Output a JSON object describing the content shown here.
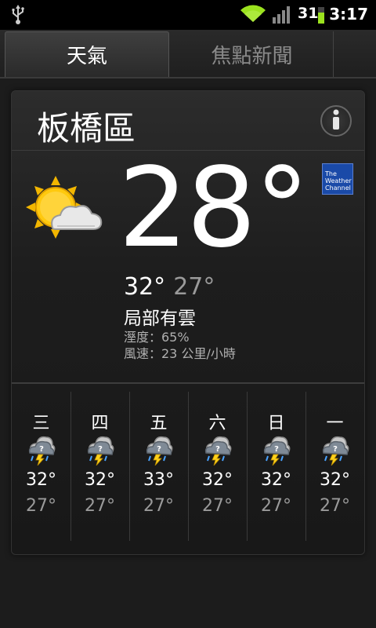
{
  "status_bar": {
    "battery": "31",
    "time": "3:17",
    "accent": "#9be21e"
  },
  "tabs": [
    {
      "label": "天氣",
      "active": true
    },
    {
      "label": "焦點新聞",
      "active": false
    }
  ],
  "current": {
    "city": "板橋區",
    "temperature": "28°",
    "high": "32°",
    "low": "27°",
    "condition": "局部有雲",
    "humidity": "溼度：65%",
    "wind": "風速：23 公里/小時",
    "provider_logo_text": "The Weather Channel",
    "icon": "partly-sunny-icon"
  },
  "forecast": [
    {
      "day": "三",
      "high": "32°",
      "low": "27°",
      "icon": "thunderstorm-icon"
    },
    {
      "day": "四",
      "high": "32°",
      "low": "27°",
      "icon": "thunderstorm-icon"
    },
    {
      "day": "五",
      "high": "33°",
      "low": "27°",
      "icon": "thunderstorm-icon"
    },
    {
      "day": "六",
      "high": "32°",
      "low": "27°",
      "icon": "thunderstorm-icon"
    },
    {
      "day": "日",
      "high": "32°",
      "low": "27°",
      "icon": "thunderstorm-icon"
    },
    {
      "day": "一",
      "high": "32°",
      "low": "27°",
      "icon": "thunderstorm-icon"
    }
  ]
}
